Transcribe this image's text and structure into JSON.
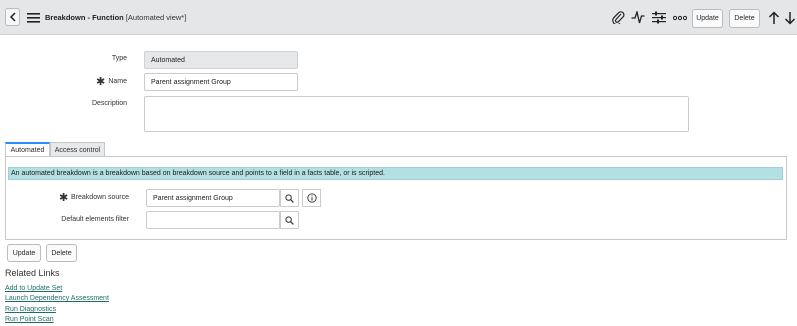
{
  "header": {
    "title": "Breakdown - Function",
    "subtitle": "[Automated view*]",
    "update_label": "Update",
    "delete_label": "Delete"
  },
  "form": {
    "type_label": "Type",
    "type_value": "Automated",
    "name_label": "Name",
    "name_value": "Parent assignment Group",
    "description_label": "Description",
    "description_value": ""
  },
  "tabs": [
    {
      "label": "Automated",
      "active": true
    },
    {
      "label": "Access control",
      "active": false
    }
  ],
  "automated": {
    "info_text": "An automated breakdown is a breakdown based on breakdown source and points to a field in a facts table, or is scripted.",
    "source_label": "Breakdown source",
    "source_value": "Parent assignment Group",
    "filter_label": "Default elements filter",
    "filter_value": ""
  },
  "footer": {
    "update_label": "Update",
    "delete_label": "Delete"
  },
  "related_links": {
    "heading": "Related Links",
    "links": [
      "Add to Update Set",
      "Launch Dependency Assessment",
      "Run Diagnostics",
      "Run Point Scan"
    ]
  },
  "icons": {
    "back": "chevron-left-icon",
    "menu": "hamburger-menu-icon",
    "attachment": "paperclip-icon",
    "activity": "pulse-icon",
    "settings": "sliders-icon",
    "more": "more-options-icon",
    "up": "arrow-up-icon",
    "down": "arrow-down-icon",
    "search": "search-icon",
    "info": "info-icon"
  }
}
